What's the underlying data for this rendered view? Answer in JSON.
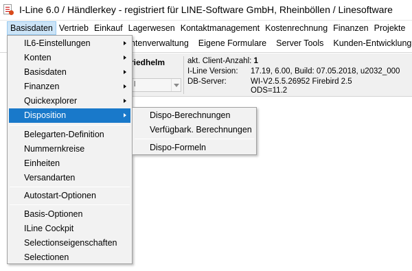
{
  "window": {
    "title": "I-Line 6.0  /  Händlerkey - registriert für LINE-Software GmbH, Rheinböllen  /  Linesoftware"
  },
  "menubar": {
    "items": [
      {
        "label": "Basisdaten",
        "active": true
      },
      {
        "label": "Vertrieb"
      },
      {
        "label": "Einkauf"
      },
      {
        "label": "Lagerwesen"
      },
      {
        "label": "Kontaktmanagement"
      },
      {
        "label": "Kostenrechnung"
      },
      {
        "label": "Finanzen"
      },
      {
        "label": "Projekte"
      }
    ]
  },
  "toolbar2": {
    "items": [
      "ntenverwaltung",
      "Eigene Formulare",
      "Server Tools",
      "Kunden-Entwicklung"
    ]
  },
  "info": {
    "user_name": "riedhelm",
    "combo_value": "l",
    "client_label": "akt. Client-Anzahl:",
    "client_value": "1",
    "version_label": "I-Line Version:",
    "version_value": "17.19, 6.00, Build: 07.05.2018, u2032_000",
    "db_label": "DB-Server:",
    "db_value": "WI-V2.5.5.26952 Firebird 2.5",
    "ods_value": "ODS=11.2"
  },
  "dropdown": {
    "items": [
      {
        "label": "IL6-Einstellungen",
        "submenu": true
      },
      {
        "label": "Konten",
        "submenu": true
      },
      {
        "label": "Basisdaten",
        "submenu": true
      },
      {
        "label": "Finanzen",
        "submenu": true
      },
      {
        "label": "Quickexplorer",
        "submenu": true
      },
      {
        "label": "Disposition",
        "submenu": true,
        "highlight": true
      },
      {
        "label": "Belegarten-Definition"
      },
      {
        "label": "Nummernkreise"
      },
      {
        "label": "Einheiten"
      },
      {
        "label": "Versandarten"
      },
      {
        "label": "Autostart-Optionen"
      },
      {
        "label": "Basis-Optionen"
      },
      {
        "label": "ILine Cockpit"
      },
      {
        "label": "Selectionseigenschaften"
      },
      {
        "label": "Selectionen"
      }
    ]
  },
  "submenu": {
    "items": [
      "Dispo-Berechnungen",
      "Verfügbark. Berechnungen",
      "Dispo-Formeln"
    ]
  },
  "colors": {
    "highlight": "#1979ca",
    "menubar_active": "#cce4f7",
    "panel_bg": "#f0f0f0"
  }
}
